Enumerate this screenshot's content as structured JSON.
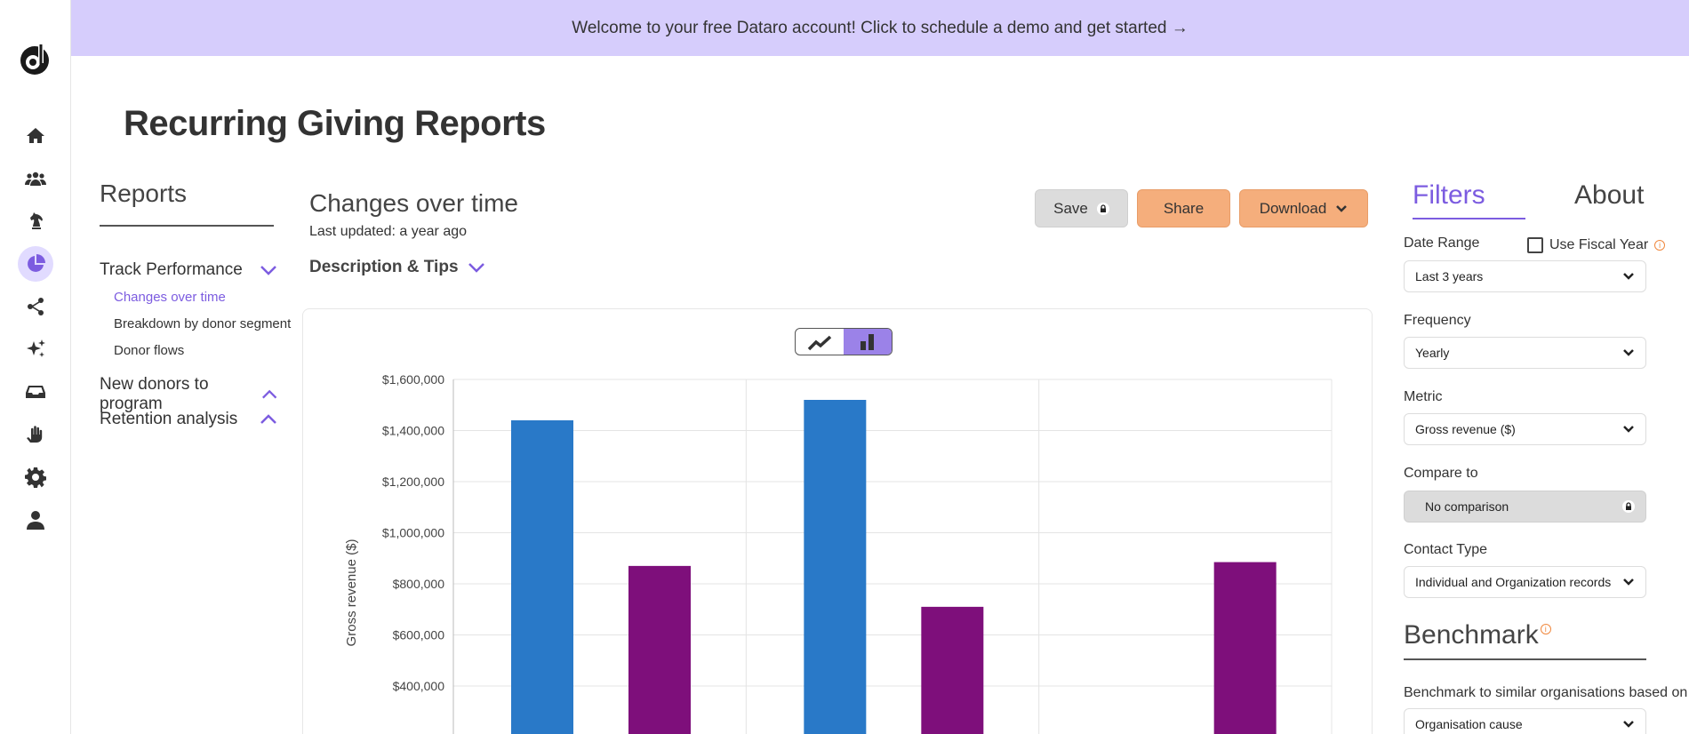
{
  "banner": {
    "text": "Welcome to your free Dataro account! Click to schedule a demo and get started →"
  },
  "page": {
    "title": "Recurring Giving Reports"
  },
  "reports_nav": {
    "heading": "Reports",
    "sections": [
      {
        "label": "Track Performance",
        "expanded": true,
        "items": [
          "Changes over time",
          "Breakdown by donor segment",
          "Donor flows"
        ]
      },
      {
        "label": "New donors to program",
        "expanded": false
      },
      {
        "label": "Retention analysis",
        "expanded": false
      }
    ],
    "active_item": "Changes over time"
  },
  "main": {
    "title": "Changes over time",
    "updated": "Last updated: a year ago",
    "description_toggle": "Description & Tips",
    "buttons": {
      "save": "Save",
      "share": "Share",
      "download": "Download"
    }
  },
  "chart_view_toggle": {
    "options": [
      "line",
      "bar"
    ],
    "selected": "bar"
  },
  "chart_data": {
    "type": "bar",
    "ylabel": "Gross revenue ($)",
    "yticks": [
      "$400,000",
      "$600,000",
      "$800,000",
      "$1,000,000",
      "$1,200,000",
      "$1,400,000",
      "$1,600,000"
    ],
    "ylim": [
      0,
      1600000
    ],
    "grid": true,
    "groups": 3,
    "series": [
      {
        "color": "#2979c8",
        "values": [
          1440000,
          1520000,
          null
        ]
      },
      {
        "color": "#7e0f7b",
        "values": [
          870000,
          710000,
          885000
        ]
      }
    ]
  },
  "filters": {
    "tabs": [
      "Filters",
      "About"
    ],
    "active_tab": "Filters",
    "date_range": {
      "label": "Date Range",
      "value": "Last 3 years"
    },
    "fiscal_year": {
      "label": "Use Fiscal Year",
      "checked": false
    },
    "frequency": {
      "label": "Frequency",
      "value": "Yearly"
    },
    "metric": {
      "label": "Metric",
      "value": "Gross revenue ($)"
    },
    "compare_to": {
      "label": "Compare to",
      "value": "No comparison",
      "locked": true
    },
    "contact_type": {
      "label": "Contact Type",
      "value": "Individual and Organization records"
    },
    "benchmark": {
      "heading": "Benchmark",
      "based_on_label": "Benchmark to similar organisations based on",
      "value": "Organisation cause"
    }
  },
  "icons": {
    "rail": [
      "home-icon",
      "donors-icon",
      "chess-knight-icon",
      "reports-pie-icon",
      "share-icon",
      "sparkles-icon",
      "inbox-icon",
      "hands-icon",
      "settings-icon",
      "user-icon"
    ],
    "accent": "#7c5ce0",
    "banner_bg": "#d6cdfc",
    "button_orange": "#f5ae7c"
  }
}
